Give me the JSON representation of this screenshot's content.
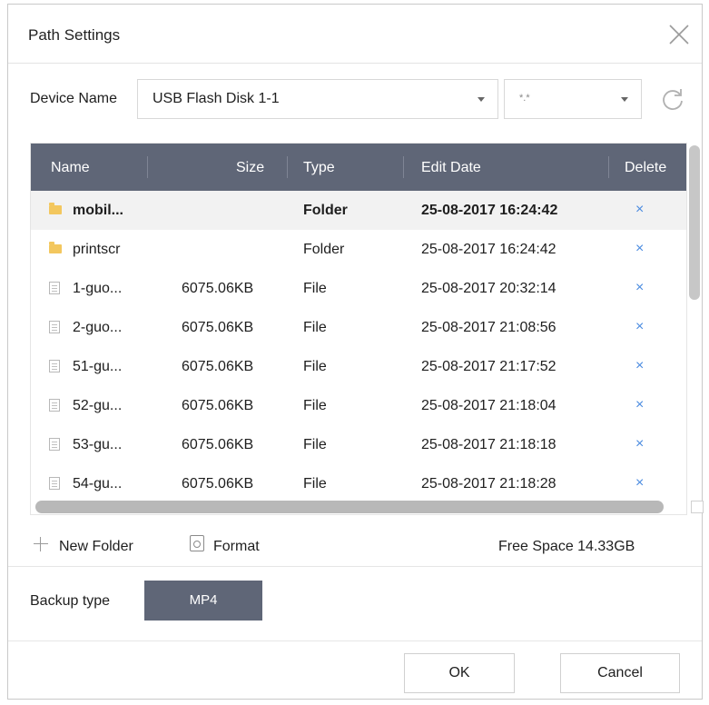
{
  "dialog": {
    "title": "Path Settings"
  },
  "device": {
    "label": "Device Name",
    "value": "USB Flash Disk 1-1",
    "filter": "*.*"
  },
  "table": {
    "headers": {
      "name": "Name",
      "size": "Size",
      "type": "Type",
      "date": "Edit Date",
      "delete": "Delete"
    },
    "rows": [
      {
        "name": "mobil...",
        "size": "",
        "type": "Folder",
        "date": "25-08-2017 16:24:42",
        "icon": "folder-icon",
        "del": "×"
      },
      {
        "name": "printscr",
        "size": "",
        "type": "Folder",
        "date": "25-08-2017 16:24:42",
        "icon": "folder-icon",
        "del": "×"
      },
      {
        "name": "1-guo...",
        "size": "6075.06KB",
        "type": "File",
        "date": "25-08-2017 20:32:14",
        "icon": "file-icon",
        "del": "×"
      },
      {
        "name": "2-guo...",
        "size": "6075.06KB",
        "type": "File",
        "date": "25-08-2017 21:08:56",
        "icon": "file-icon",
        "del": "×"
      },
      {
        "name": "51-gu...",
        "size": "6075.06KB",
        "type": "File",
        "date": "25-08-2017 21:17:52",
        "icon": "file-icon",
        "del": "×"
      },
      {
        "name": "52-gu...",
        "size": "6075.06KB",
        "type": "File",
        "date": "25-08-2017 21:18:04",
        "icon": "file-icon",
        "del": "×"
      },
      {
        "name": "53-gu...",
        "size": "6075.06KB",
        "type": "File",
        "date": "25-08-2017 21:18:18",
        "icon": "file-icon",
        "del": "×"
      },
      {
        "name": "54-gu...",
        "size": "6075.06KB",
        "type": "File",
        "date": "25-08-2017 21:18:28",
        "icon": "file-icon",
        "del": "×"
      }
    ]
  },
  "tools": {
    "new_folder": "New Folder",
    "format": "Format",
    "free_space": "Free Space 14.33GB"
  },
  "backup": {
    "label": "Backup type",
    "value": "MP4"
  },
  "buttons": {
    "ok": "OK",
    "cancel": "Cancel"
  },
  "colors": {
    "header_bg": "#5f6677",
    "delete_x": "#4b8be0",
    "folder": "#f3c75e"
  }
}
